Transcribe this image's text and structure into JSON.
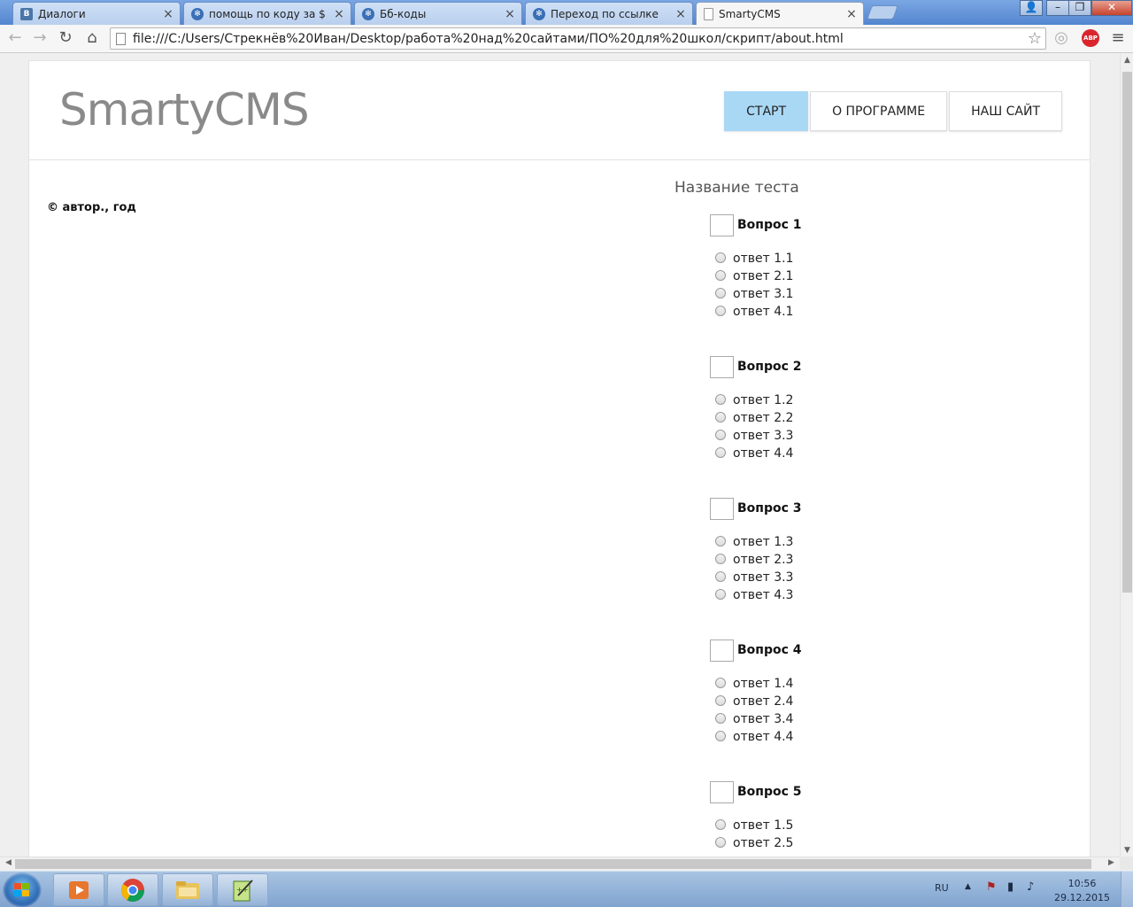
{
  "browser": {
    "tabs": [
      {
        "title": "Диалоги",
        "icon": "vk-icon",
        "active": false
      },
      {
        "title": "помощь по коду за $",
        "icon": "globe-icon",
        "active": false
      },
      {
        "title": "Бб-коды",
        "icon": "globe-icon",
        "active": false
      },
      {
        "title": "Переход по ссылке",
        "icon": "globe-icon",
        "active": false
      },
      {
        "title": "SmartyCMS",
        "icon": "page-icon",
        "active": true
      }
    ],
    "url": "file:///C:/Users/Стрекнёв%20Иван/Desktop/работа%20над%20сайтами/ПО%20для%20школ/скрипт/about.html",
    "extension_label": "ABP"
  },
  "site": {
    "logo": "SmartyCMS",
    "nav": [
      {
        "label": "СТАРТ",
        "active": true
      },
      {
        "label": "О ПРОГРАММЕ",
        "active": false
      },
      {
        "label": "НАШ САЙТ",
        "active": false
      }
    ],
    "footer": "© автор., год",
    "accent_color": "#a9d8f5"
  },
  "quiz": {
    "title": "Название теста",
    "questions": [
      {
        "label": "Вопрос 1",
        "answers": [
          "ответ 1.1",
          "ответ 2.1",
          "ответ 3.1",
          "ответ 4.1"
        ]
      },
      {
        "label": "Вопрос 2",
        "answers": [
          "ответ 1.2",
          "ответ 2.2",
          "ответ 3.3",
          "ответ 4.4"
        ]
      },
      {
        "label": "Вопрос 3",
        "answers": [
          "ответ 1.3",
          "ответ 2.3",
          "ответ 3.3",
          "ответ 4.3"
        ]
      },
      {
        "label": "Вопрос 4",
        "answers": [
          "ответ 1.4",
          "ответ 2.4",
          "ответ 3.4",
          "ответ 4.4"
        ]
      },
      {
        "label": "Вопрос 5",
        "answers": [
          "ответ 1.5",
          "ответ 2.5"
        ]
      }
    ]
  },
  "taskbar": {
    "language": "RU",
    "time": "10:56",
    "date": "29.12.2015"
  }
}
